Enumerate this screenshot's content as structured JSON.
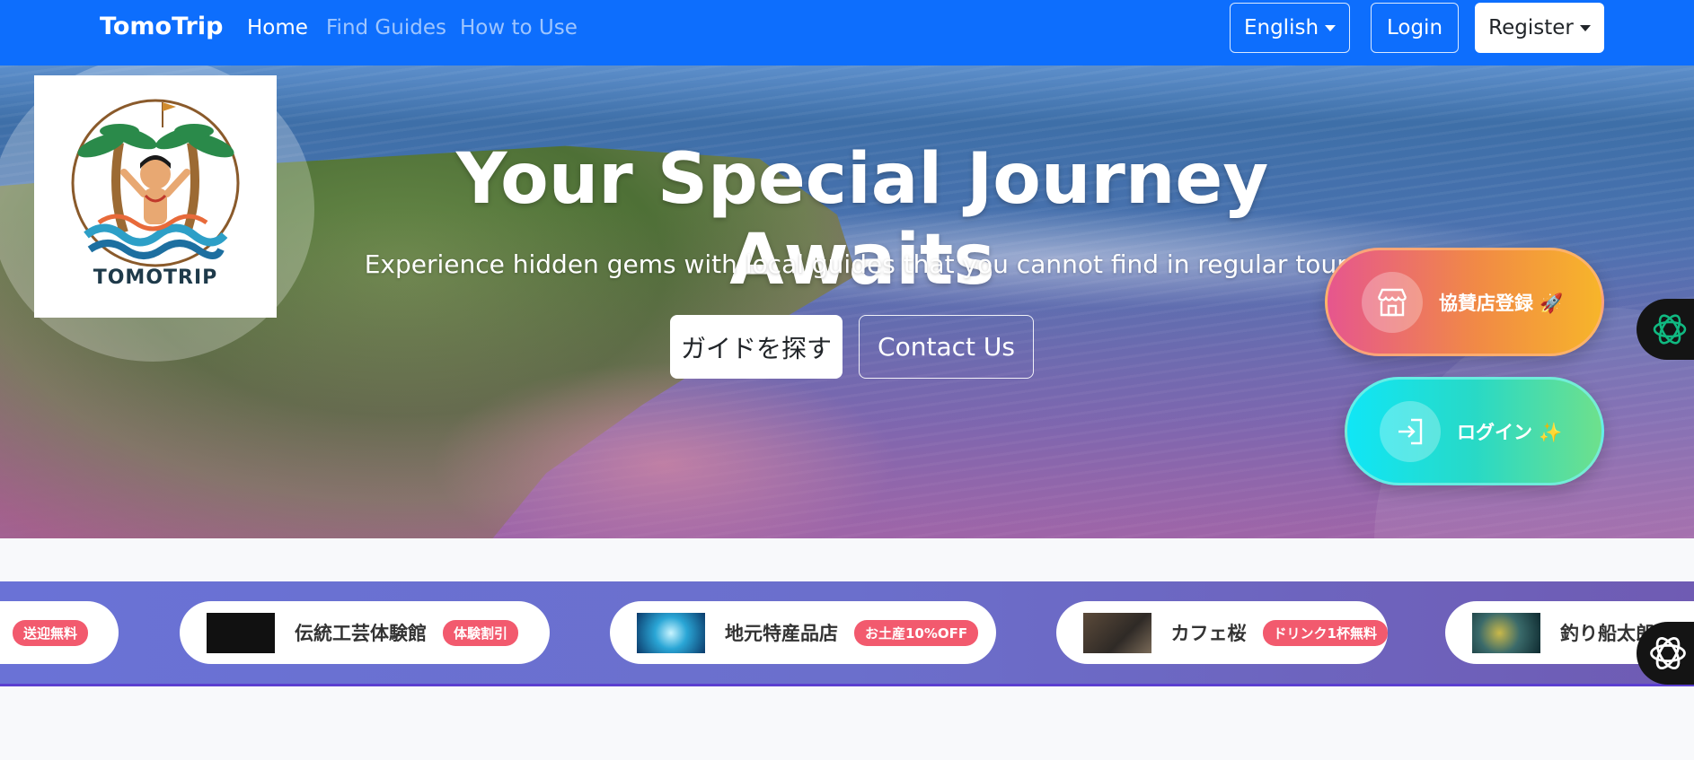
{
  "nav": {
    "brand": "TomoTrip",
    "links": [
      "Home",
      "Find Guides",
      "How to Use"
    ],
    "language": "English",
    "login": "Login",
    "register": "Register"
  },
  "hero": {
    "logo_text": "TOMOTRIP",
    "title": "Your Special Journey Awaits",
    "subtitle": "Experience hidden gems with local guides that you cannot find in regular tours",
    "primary_button": "ガイドを探す",
    "secondary_button": "Contact Us"
  },
  "floating": {
    "partner_register": "協賛店登録 🚀",
    "login": "ログイン ✨"
  },
  "shops": [
    {
      "name": "",
      "badge": "送迎無料"
    },
    {
      "name": "伝統工芸体験館",
      "badge": "体験割引"
    },
    {
      "name": "地元特産品店",
      "badge": "お土産10%OFF"
    },
    {
      "name": "カフェ桜",
      "badge": "ドリンク1杯無料"
    },
    {
      "name": "釣り船太郎",
      "badge": ""
    }
  ],
  "icons": {
    "shop": "store-icon",
    "login": "sign-in-icon",
    "chat": "openai-icon"
  },
  "colors": {
    "navbar": "#0d6efd",
    "badge": "#f25a6e",
    "strip": "#6a72d6"
  }
}
